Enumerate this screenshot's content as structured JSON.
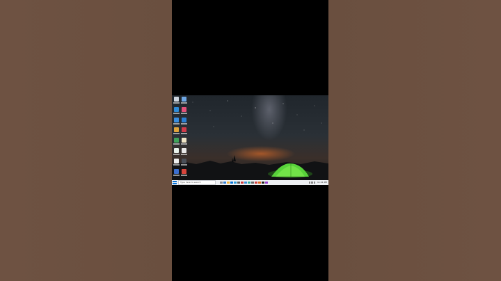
{
  "desktop": {
    "icons": [
      {
        "name": "recycle-bin-icon",
        "color": "#cfd6df"
      },
      {
        "name": "folder-icon",
        "color": "#6ea6e4"
      },
      {
        "name": "edge-icon",
        "color": "#2e8bd8"
      },
      {
        "name": "app-icon-pink",
        "color": "#e4507a"
      },
      {
        "name": "edge-icon-2",
        "color": "#3a8ee0"
      },
      {
        "name": "vscode-icon",
        "color": "#2a7fd4"
      },
      {
        "name": "chrome-icon",
        "color": "#e0a43a"
      },
      {
        "name": "app-icon-red",
        "color": "#d13b4a"
      },
      {
        "name": "app-icon-green",
        "color": "#3fa35a"
      },
      {
        "name": "file-icon",
        "color": "#f0e6c8"
      },
      {
        "name": "whatsapp-icon",
        "color": "#e9f3ec"
      },
      {
        "name": "document-icon",
        "color": "#e8e8e8"
      },
      {
        "name": "file-icon-2",
        "color": "#eeeeee"
      },
      {
        "name": "app-icon-dark",
        "color": "#4a4f58"
      },
      {
        "name": "app-icon-blue",
        "color": "#3c6fd0"
      },
      {
        "name": "app-icon-red-2",
        "color": "#d8453c"
      }
    ]
  },
  "taskbar": {
    "search_placeholder": "Type here to search",
    "app_colors": [
      "#8a8f98",
      "#2f7fd6",
      "#f3b53d",
      "#0a74d8",
      "#2b9bd8",
      "#5a5a5a",
      "#d03b3b",
      "#3b8ed8",
      "#2fb0a0",
      "#6a6a6a",
      "#d24040",
      "#e26a1c",
      "#222222",
      "#9a3fd0"
    ],
    "clock": "11:21 PM"
  },
  "colors": {
    "side_bg": "#6b5040",
    "tent": "#58d23a",
    "glow": "#ff7a28"
  }
}
